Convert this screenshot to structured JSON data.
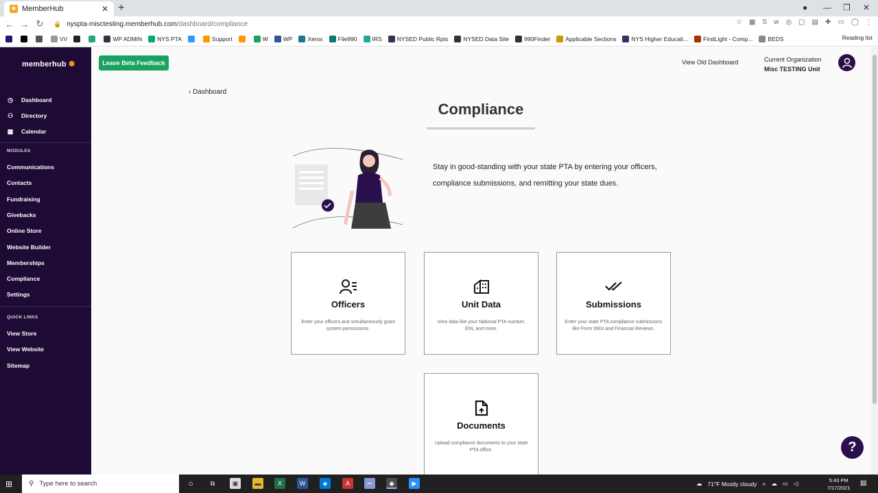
{
  "browser": {
    "tab_title": "MemberHub",
    "url_host": "nyspta-misctesting.memberhub.com",
    "url_path": "/dashboard/compliance",
    "bookmarks": [
      "",
      "",
      "",
      "VV",
      "",
      "",
      "WP ADMIN",
      "NYS PTA",
      "",
      "Support",
      "",
      "W",
      "WP",
      "Xerox",
      "File990",
      "IRS",
      "NYSED Public Rpts",
      "NYSED Data Site",
      "990Finder",
      "Applicable Sections",
      "NYS Higher Educati...",
      "FirstLight - Comp...",
      "BEDS"
    ],
    "reading_list": "Reading list"
  },
  "sidebar": {
    "logo": "memberhub",
    "top_items": [
      {
        "label": "Dashboard",
        "icon": "dashboard-icon"
      },
      {
        "label": "Directory",
        "icon": "directory-icon"
      },
      {
        "label": "Calendar",
        "icon": "calendar-icon"
      }
    ],
    "modules_heading": "MODULES",
    "modules": [
      "Communications",
      "Contacts",
      "Fundraising",
      "Givebacks",
      "Online Store",
      "Website Builder",
      "Memberships",
      "Compliance",
      "Settings"
    ],
    "quick_heading": "QUICK LINKS",
    "quick_links": [
      "View Store",
      "View Website",
      "Sitemap"
    ]
  },
  "header": {
    "feedback_button": "Leave Beta Feedback",
    "old_dashboard": "View Old Dashboard",
    "org_label": "Current Organization",
    "org_name": "Misc TESTING Unit"
  },
  "page": {
    "back_link": "Dashboard",
    "title": "Compliance",
    "intro": "Stay in good-standing with your state PTA by entering your officers, compliance submissions, and remitting your state dues.",
    "cards": [
      {
        "title": "Officers",
        "desc": "Enter your officers and simultaneously grant system permissions.",
        "icon": "officers-icon"
      },
      {
        "title": "Unit Data",
        "desc": "View data like your National PTA number, EIN, and more.",
        "icon": "unit-data-icon"
      },
      {
        "title": "Submissions",
        "desc": "Enter your state PTA compliance submissions like Form 990s and Financial Reviews.",
        "icon": "submissions-icon"
      },
      {
        "title": "Documents",
        "desc": "Upload compliance documents to your state PTA office.",
        "icon": "documents-icon"
      }
    ],
    "help": "?"
  },
  "taskbar": {
    "search_placeholder": "Type here to search",
    "weather": "71°F  Mostly cloudy",
    "time": "5:43 PM",
    "date": "7/17/2021"
  },
  "colors": {
    "sidebar": "#1e0b35",
    "accent_green": "#1aa260",
    "dark_purple": "#2a0f4c",
    "logo_dot": "#f7931e"
  }
}
